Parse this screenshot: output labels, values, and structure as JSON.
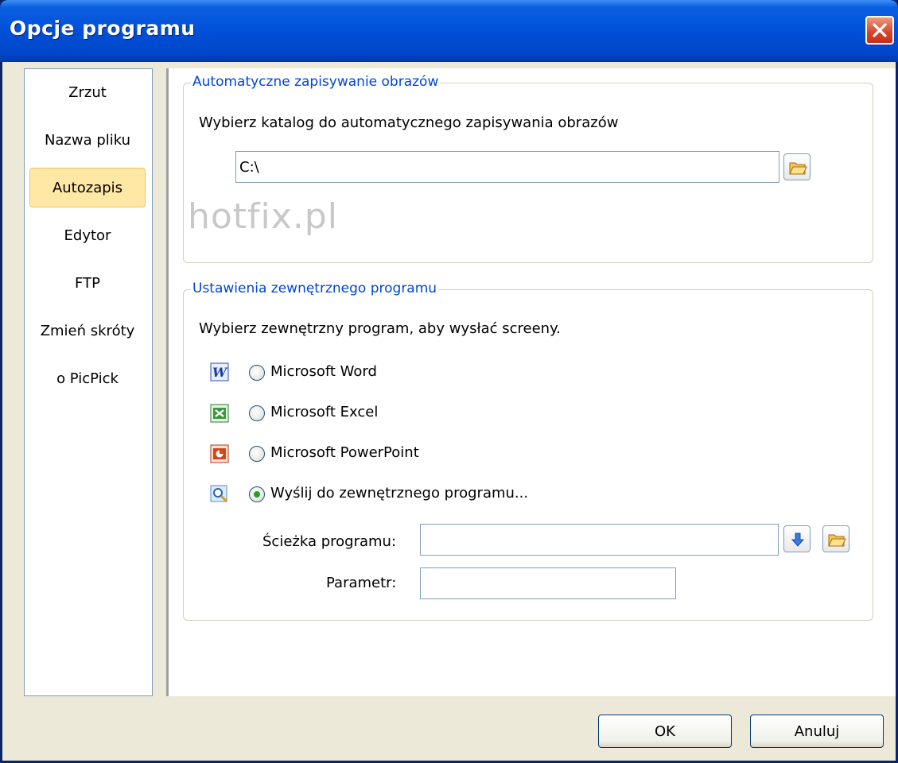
{
  "window": {
    "title": "Opcje programu"
  },
  "nav": {
    "items": [
      {
        "label": "Zrzut"
      },
      {
        "label": "Nazwa pliku"
      },
      {
        "label": "Autozapis",
        "active": true
      },
      {
        "label": "Edytor"
      },
      {
        "label": "FTP"
      },
      {
        "label": "Zmień skróty"
      },
      {
        "label": "o PicPick"
      }
    ]
  },
  "autosave": {
    "group_title": "Automatyczne zapisywanie obrazów",
    "description": "Wybierz katalog do automatycznego zapisywania obrazów",
    "folder_value": "C:\\",
    "watermark": "hotfix.pl"
  },
  "external": {
    "group_title": "Ustawienia zewnętrznego programu",
    "description": "Wybierz zewnętrzny program, aby wysłać screeny.",
    "options": [
      {
        "label": "Microsoft Word",
        "icon": "word-icon",
        "selected": false
      },
      {
        "label": "Microsoft Excel",
        "icon": "excel-icon",
        "selected": false
      },
      {
        "label": "Microsoft PowerPoint",
        "icon": "powerpoint-icon",
        "selected": false
      },
      {
        "label": "Wyślij do zewnętrznego programu...",
        "icon": "external-program-icon",
        "selected": true
      }
    ],
    "path_label": "Ścieżka programu:",
    "path_value": "",
    "param_label": "Parametr:",
    "param_value": ""
  },
  "buttons": {
    "ok": "OK",
    "cancel": "Anuluj"
  }
}
